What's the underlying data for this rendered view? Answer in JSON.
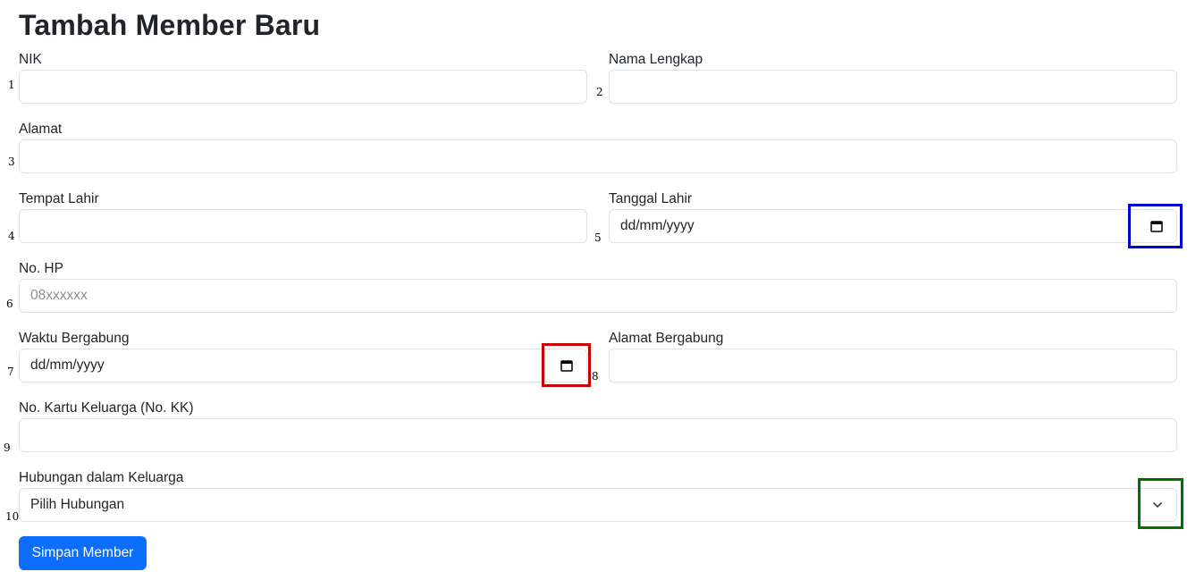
{
  "page": {
    "title": "Tambah Member Baru"
  },
  "fields": {
    "nik": {
      "label": "NIK",
      "value": "",
      "number": "1"
    },
    "nama": {
      "label": "Nama Lengkap",
      "value": "",
      "number": "2"
    },
    "alamat": {
      "label": "Alamat",
      "value": "",
      "number": "3"
    },
    "tempat_lahir": {
      "label": "Tempat Lahir",
      "value": "",
      "number": "4"
    },
    "tanggal_lahir": {
      "label": "Tanggal Lahir",
      "value": "dd/mm/yyyy",
      "number": "5"
    },
    "no_hp": {
      "label": "No. HP",
      "placeholder": "08xxxxxx",
      "number": "6"
    },
    "waktu_bergabung": {
      "label": "Waktu Bergabung",
      "value": "dd/mm/yyyy",
      "number": "7"
    },
    "alamat_bergabung": {
      "label": "Alamat Bergabung",
      "value": "",
      "number": "8"
    },
    "no_kk": {
      "label": "No. Kartu Keluarga (No. KK)",
      "value": "",
      "number": "9"
    },
    "hubungan": {
      "label": "Hubungan dalam Keluarga",
      "selected": "Pilih Hubungan",
      "number": "10"
    }
  },
  "submit": {
    "label": "Simpan Member"
  },
  "icons": {
    "date_picker": "calendar-icon",
    "select": "chevron-down-icon"
  },
  "colors": {
    "primary_button": "#0d6efd",
    "highlight_tanggal_lahir": "#0000cc",
    "highlight_waktu_bergabung": "#cc0000",
    "highlight_hubungan": "#007000"
  }
}
